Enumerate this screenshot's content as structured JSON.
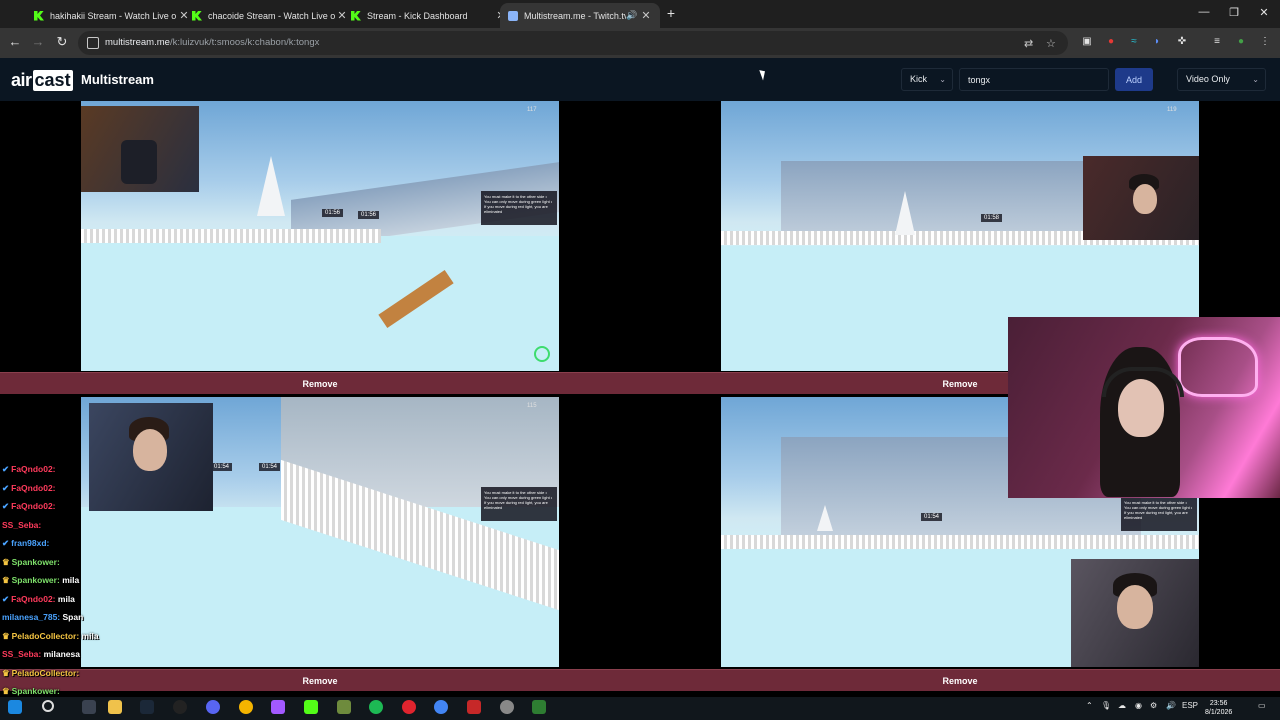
{
  "browser": {
    "tabs": [
      {
        "title": "hakihakii Stream - Watch Live o",
        "icon": "kick-icon"
      },
      {
        "title": "chacoide Stream - Watch Live o",
        "icon": "kick-icon"
      },
      {
        "title": "Stream - Kick Dashboard",
        "icon": "kick-icon"
      },
      {
        "title": "Multistream.me - Twitch.tv",
        "icon": "multistream-icon",
        "active": true
      }
    ],
    "url_host": "multistream.me",
    "url_path": "/k:luizvuk/t:smoos/k:chabon/k:tongx"
  },
  "app": {
    "logo_air": "air",
    "logo_cast": "cast",
    "title": "Multistream",
    "platform_select": "Kick",
    "channel_input_value": "tongx",
    "add_label": "Add",
    "mode_select": "Video Only"
  },
  "streams": [
    {
      "viewers": "117",
      "timer_a": "01:56",
      "timer_b": "01:56",
      "remove_label": "Remove"
    },
    {
      "viewers": "119",
      "timer_a": "01:58",
      "remove_label": "Remove"
    },
    {
      "viewers": "115",
      "timer_a": "01:54",
      "timer_b": "01:54",
      "remove_label": "Remove"
    },
    {
      "viewers": "",
      "timer_a": "01:54",
      "remove_label": "Remove"
    }
  ],
  "hud_text": "You must make it to the other side • You can only move during green light • If you move during red light, you are eliminated",
  "chat": [
    {
      "user": "FaQndo02:",
      "color": "#ff3b5c",
      "msg": ""
    },
    {
      "user": "FaQndo02:",
      "color": "#ff3b5c",
      "msg": ""
    },
    {
      "user": "FaQndo02:",
      "color": "#ff3b5c",
      "msg": ""
    },
    {
      "user": "SS_Seba:",
      "color": "#ff3b5c",
      "msg": ""
    },
    {
      "user": "fran98xd:",
      "color": "#4aa3ff",
      "msg": ""
    },
    {
      "user": "Spankower:",
      "color": "#7ee06a",
      "msg": ""
    },
    {
      "user": "Spankower:",
      "color": "#7ee06a",
      "msg": "mila"
    },
    {
      "user": "FaQndo02:",
      "color": "#ff3b5c",
      "msg": "mila"
    },
    {
      "user": "milanesa_785:",
      "color": "#4aa3ff",
      "msg": "Span"
    },
    {
      "user": "PeladoCollector:",
      "color": "#f5c542",
      "msg": "mila"
    },
    {
      "user": "SS_Seba:",
      "color": "#ff3b5c",
      "msg": "milanesa"
    },
    {
      "user": "PeladoCollector:",
      "color": "#f5c542",
      "msg": ""
    },
    {
      "user": "Spankower:",
      "color": "#7ee06a",
      "msg": ""
    },
    {
      "user": "Spankower:",
      "color": "#7ee06a",
      "msg": ""
    }
  ],
  "taskbar": {
    "lang": "ESP",
    "time": "23:56",
    "date": "8/1/2026"
  }
}
